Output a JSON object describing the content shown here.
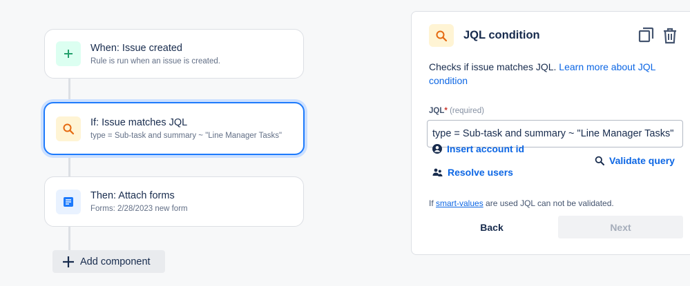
{
  "rule": {
    "trigger": {
      "title": "When: Issue created",
      "subtitle": "Rule is run when an issue is created."
    },
    "condition": {
      "title": "If: Issue matches JQL",
      "subtitle": "type = Sub-task and summary ~ \"Line Manager Tasks\""
    },
    "action": {
      "title": "Then: Attach forms",
      "subtitle": "Forms: 2/28/2023 new form"
    },
    "add_component_label": "Add component"
  },
  "panel": {
    "title": "JQL condition",
    "description": "Checks if issue matches JQL.",
    "learn_more": "Learn more about JQL condition",
    "jql_label": "JQL",
    "required_marker": "*",
    "required_text": "(required)",
    "jql_value": "type = Sub-task and summary ~ \"Line Manager Tasks\"",
    "insert_account_label": "Insert account id",
    "resolve_users_label": "Resolve users",
    "validate_query_label": "Validate query",
    "note_prefix": "If",
    "note_link": "smart-values",
    "note_suffix": "are used JQL can not be validated.",
    "back_label": "Back",
    "next_label": "Next"
  },
  "icons": {
    "trigger": "plus-icon",
    "condition": "search-icon",
    "action": "form-icon",
    "copy": "copy-icon",
    "delete": "trash-icon",
    "account": "user-circle-icon",
    "users": "people-icon",
    "validate": "search-icon"
  },
  "colors": {
    "accent": "#0c66e4",
    "selected_border": "#1d7afc",
    "trigger_icon": "#22a06b",
    "condition_icon": "#e56910",
    "action_icon": "#1d7afc"
  }
}
